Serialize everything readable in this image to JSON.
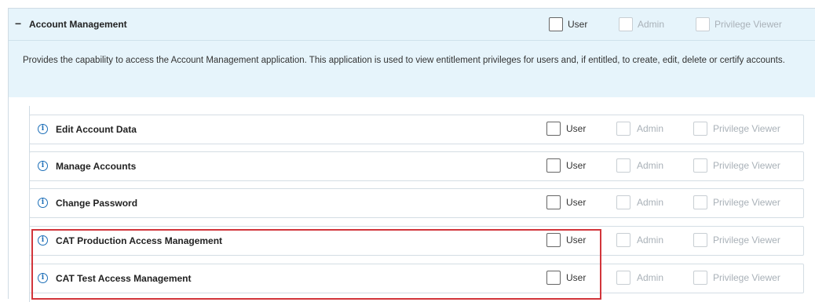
{
  "section": {
    "collapse_glyph": "−",
    "title": "Account Management",
    "description": "Provides the capability to access the Account Management application. This application is used to view entitlement privileges for users and, if entitled, to create, edit, delete or certify accounts.",
    "role_labels": {
      "user": "User",
      "admin": "Admin",
      "viewer": "Privilege Viewer"
    }
  },
  "info_glyph": "i",
  "rows": [
    {
      "title": "Edit Account Data",
      "user": "User",
      "admin": "Admin",
      "viewer": "Privilege Viewer"
    },
    {
      "title": "Manage Accounts",
      "user": "User",
      "admin": "Admin",
      "viewer": "Privilege Viewer"
    },
    {
      "title": "Change Password",
      "user": "User",
      "admin": "Admin",
      "viewer": "Privilege Viewer"
    },
    {
      "title": "CAT Production Access Management",
      "user": "User",
      "admin": "Admin",
      "viewer": "Privilege Viewer"
    },
    {
      "title": "CAT Test Access Management",
      "user": "User",
      "admin": "Admin",
      "viewer": "Privilege Viewer"
    }
  ],
  "colors": {
    "header_bg": "#e6f4fb",
    "highlight": "#d2353b",
    "info_icon": "#1d6fb8"
  }
}
